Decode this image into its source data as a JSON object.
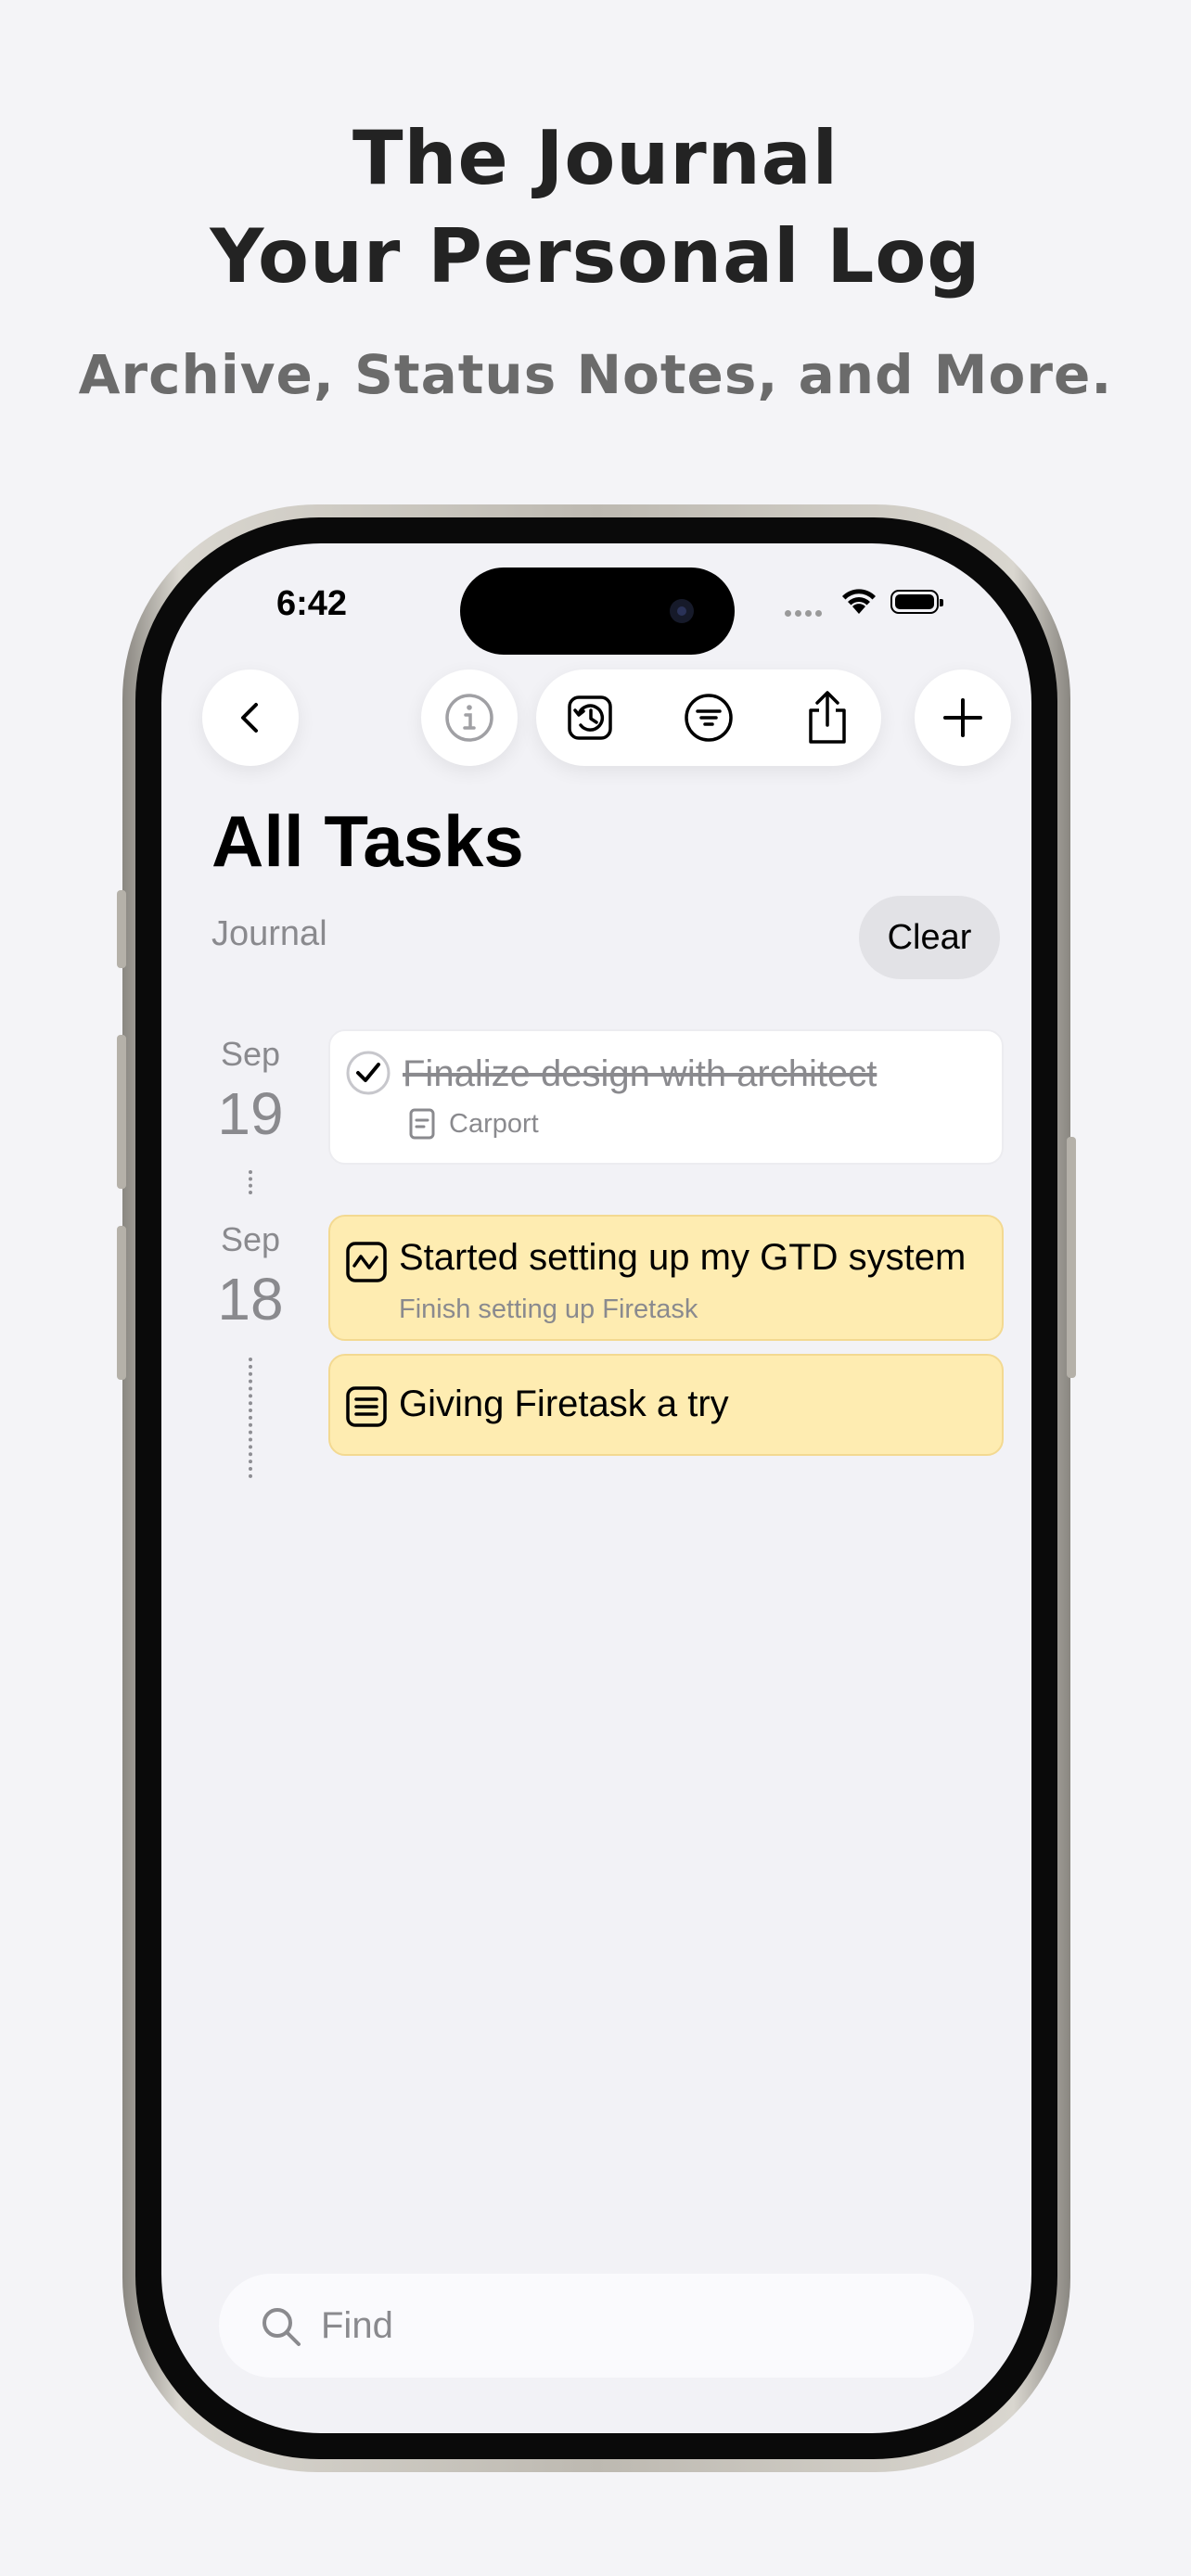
{
  "promo": {
    "headline_line1": "The Journal",
    "headline_line2": "Your Personal Log",
    "subheadline": "Archive, Status Notes, and More."
  },
  "status_bar": {
    "time": "6:42"
  },
  "toolbar": {
    "back_icon": "chevron-left-icon",
    "info_icon": "info-icon",
    "history_icon": "clock-history-icon",
    "filter_icon": "filter-icon",
    "share_icon": "share-icon",
    "add_icon": "plus-icon"
  },
  "header": {
    "title": "All Tasks",
    "subtitle": "Journal",
    "clear_label": "Clear"
  },
  "timeline": [
    {
      "month": "Sep",
      "day": "19",
      "entries": [
        {
          "type": "completed-task",
          "title": "Finalize design with architect",
          "project_icon": "document-icon",
          "project": "Carport",
          "color": "#ffffff"
        }
      ]
    },
    {
      "month": "Sep",
      "day": "18",
      "entries": [
        {
          "type": "status-note",
          "icon": "activity-icon",
          "title": "Started setting up my GTD system",
          "subtitle": "Finish setting up Firetask",
          "color": "#feecb1"
        },
        {
          "type": "note",
          "icon": "note-lines-icon",
          "title": "Giving Firetask a try",
          "color": "#feecb1"
        }
      ]
    }
  ],
  "search": {
    "placeholder": "Find"
  }
}
